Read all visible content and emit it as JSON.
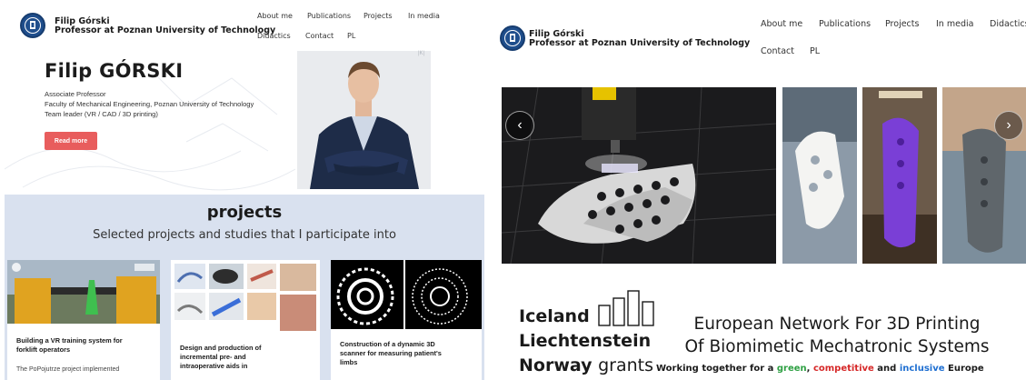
{
  "left": {
    "brand": {
      "name": "Filip Górski",
      "role": "Professor at Poznan University of Technology"
    },
    "nav": [
      "About me",
      "Publications",
      "Projects",
      "In media",
      "Didactics",
      "Contact",
      "PL"
    ],
    "hero": {
      "name": "Filip GÓRSKI",
      "lines": [
        "Associate Professor",
        "Faculty of Mechanical Engineering, Poznan University of Technology",
        "Team leader (VR / CAD / 3D printing)"
      ],
      "button": "Read more"
    },
    "projects": {
      "title": "projects",
      "subtitle": "Selected projects and studies that I participate into",
      "cards": [
        {
          "title_lines": [
            "Building a VR training system for",
            "forklift operators"
          ],
          "desc": "The PoPojutrze project implemented"
        },
        {
          "title_lines": [
            "Design and production of",
            "incremental pre- and",
            "intraoperative aids in"
          ],
          "desc": ""
        },
        {
          "title_lines": [
            "Construction of a dynamic 3D",
            "scanner for measuring patient's",
            "limbs"
          ],
          "desc": ""
        }
      ]
    }
  },
  "right": {
    "brand": {
      "name": "Filip Górski",
      "role": "Professor at Poznan University of Technology"
    },
    "nav": [
      "About me",
      "Publications",
      "Projects",
      "In media",
      "Didactics",
      "Contact",
      "PL"
    ],
    "grants": {
      "line1": "Iceland",
      "line2": "Liechtenstein",
      "line3a": "Norway",
      "line3b": "grants"
    },
    "network_title": [
      "European Network For 3D Printing",
      "Of Biomimetic Mechatronic Systems"
    ],
    "tagline": {
      "prefix": "Working together for a ",
      "green": "green",
      "sep1": ", ",
      "competitive": "competitive",
      "sep2": " and ",
      "inclusive": "inclusive",
      "suffix": " Europe"
    },
    "colors": {
      "green": "#2ea043",
      "red": "#d62828",
      "blue": "#1f6fd1"
    }
  },
  "icons": {
    "prev": "chevron-left-icon",
    "next": "chevron-right-icon"
  }
}
